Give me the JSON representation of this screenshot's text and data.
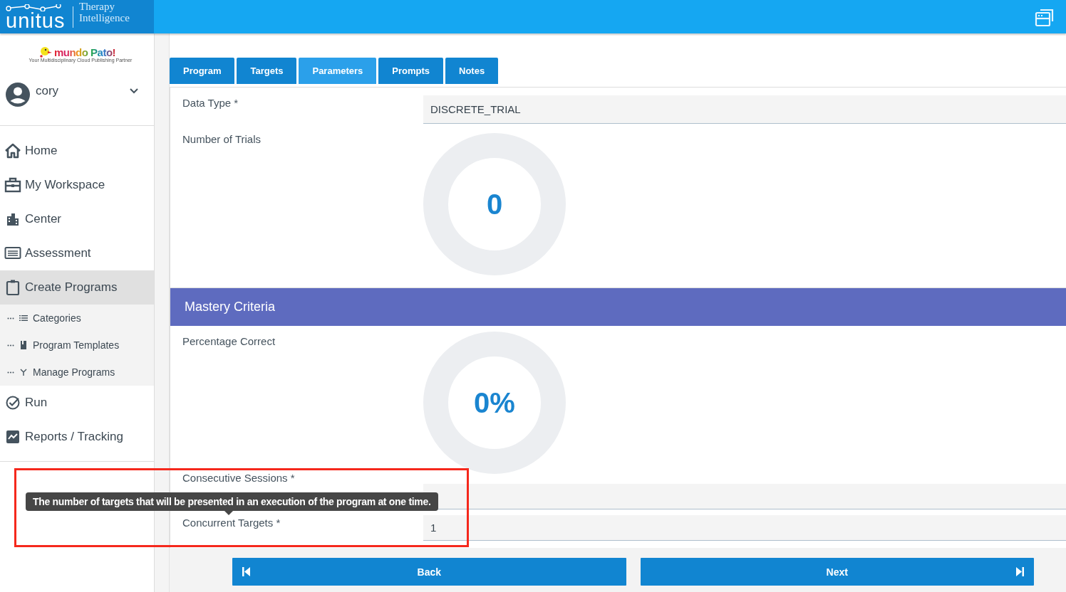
{
  "header": {
    "logo": {
      "name": "unitus",
      "line_1": "Therapy",
      "line_2": "Intelligence"
    }
  },
  "sidebar": {
    "brand": {
      "name": "mundo Pato!",
      "tagline": "Your Multidisciplinary Cloud Publishing Partner"
    },
    "user": {
      "name": "cory"
    },
    "items": [
      {
        "label": "Home",
        "selected": false
      },
      {
        "label": "My Workspace",
        "selected": false
      },
      {
        "label": "Center",
        "selected": false
      },
      {
        "label": "Assessment",
        "selected": false
      },
      {
        "label": "Create Programs",
        "selected": true,
        "expanded": true,
        "children": [
          {
            "label": "Categories"
          },
          {
            "label": "Program Templates"
          },
          {
            "label": "Manage Programs"
          }
        ]
      },
      {
        "label": "Run",
        "selected": false
      },
      {
        "label": "Reports / Tracking",
        "selected": false
      }
    ]
  },
  "tabs": [
    {
      "label": "Program",
      "selected": false
    },
    {
      "label": "Targets",
      "selected": false
    },
    {
      "label": "Parameters",
      "selected": true
    },
    {
      "label": "Prompts",
      "selected": false
    },
    {
      "label": "Notes",
      "selected": false
    }
  ],
  "form": [
    {
      "kind": "field",
      "label": "Data Type *",
      "value": "DISCRETE_TRIAL"
    },
    {
      "kind": "gauge",
      "label": "Number of Trials",
      "value": "0",
      "level": 0
    },
    {
      "kind": "section",
      "label": "Mastery Criteria"
    },
    {
      "kind": "gauge",
      "label": "Percentage Correct",
      "value": "0%",
      "level": 0
    },
    {
      "kind": "field",
      "label": "Consecutive Sessions *"
    },
    {
      "kind": "field",
      "label": "Concurrent Targets *",
      "value": "1"
    }
  ],
  "tooltip": {
    "text": "The number of targets that will be presented in an execution of the program at one time."
  },
  "buttons": [
    {
      "kind": "back",
      "label": "Back"
    },
    {
      "kind": "next",
      "label": "Next"
    }
  ]
}
